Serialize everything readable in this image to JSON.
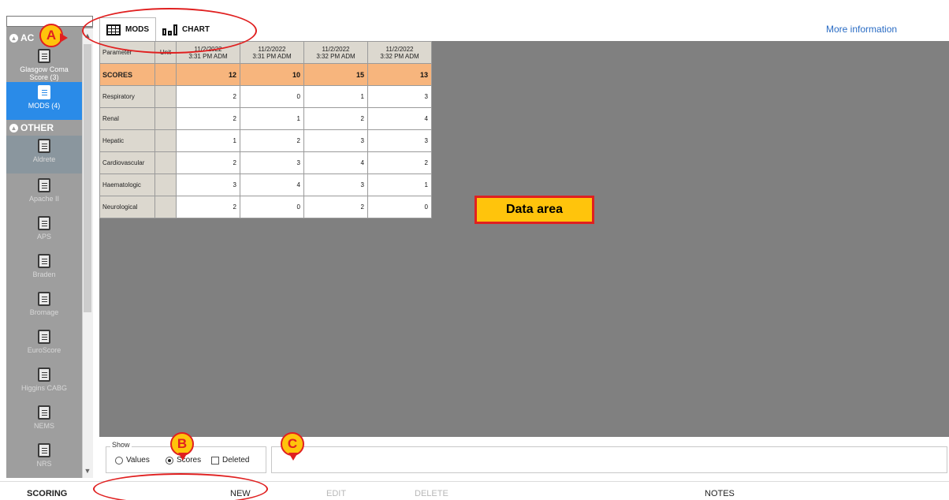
{
  "sidebar": {
    "search_value": "",
    "groups": [
      {
        "label": "AC"
      },
      {
        "label": "OTHER"
      }
    ],
    "items": [
      {
        "label": "Glasgow Coma Score (3)"
      },
      {
        "label": "MODS (4)"
      },
      {
        "label": "Aldrete"
      },
      {
        "label": "Apache II"
      },
      {
        "label": "APS"
      },
      {
        "label": "Braden"
      },
      {
        "label": "Bromage"
      },
      {
        "label": "EuroScore"
      },
      {
        "label": "Higgins CABG"
      },
      {
        "label": "NEMS"
      },
      {
        "label": "NRS"
      }
    ],
    "icon": "document-icon"
  },
  "tabs": [
    {
      "label": "MODS",
      "icon": "grid-icon",
      "active": true
    },
    {
      "label": "CHART",
      "icon": "bar-chart-icon",
      "active": false
    }
  ],
  "header": {
    "more_info": "More information"
  },
  "table": {
    "headers": {
      "param": "Parameter",
      "unit": "Unit",
      "columns": [
        {
          "date": "11/2/2022",
          "time": "3:31 PM ADM"
        },
        {
          "date": "11/2/2022",
          "time": "3:31 PM ADM"
        },
        {
          "date": "11/2/2022",
          "time": "3:32 PM ADM"
        },
        {
          "date": "11/2/2022",
          "time": "3:32 PM ADM"
        }
      ]
    },
    "rows": [
      {
        "name": "SCORES",
        "values": [
          "12",
          "10",
          "15",
          "13"
        ]
      },
      {
        "name": "Respiratory",
        "values": [
          "2",
          "0",
          "1",
          "3"
        ]
      },
      {
        "name": "Renal",
        "values": [
          "2",
          "1",
          "2",
          "4"
        ]
      },
      {
        "name": "Hepatic",
        "values": [
          "1",
          "2",
          "3",
          "3"
        ]
      },
      {
        "name": "Cardiovascular",
        "values": [
          "2",
          "3",
          "4",
          "2"
        ]
      },
      {
        "name": "Haematologic",
        "values": [
          "3",
          "4",
          "3",
          "1"
        ]
      },
      {
        "name": "Neurological",
        "values": [
          "2",
          "0",
          "2",
          "0"
        ]
      }
    ]
  },
  "data_area_label": "Data area",
  "show": {
    "title": "Show",
    "values_label": "Values",
    "scores_label": "Scores",
    "deleted_label": "Deleted",
    "selected": "Scores"
  },
  "bottom": {
    "scoring": "SCORING",
    "new": "NEW",
    "edit": "EDIT",
    "delete": "DELETE",
    "notes": "NOTES"
  },
  "callouts": {
    "a": "A",
    "b": "B",
    "c": "C"
  },
  "colors": {
    "sidebar": "#9e9e9e",
    "active_item": "#2a8be8",
    "scores_row": "#f7b57d",
    "data_area": "#808080",
    "callout_fill": "#ffc40c",
    "callout_stroke": "#e02020",
    "link": "#2a6cc4"
  }
}
